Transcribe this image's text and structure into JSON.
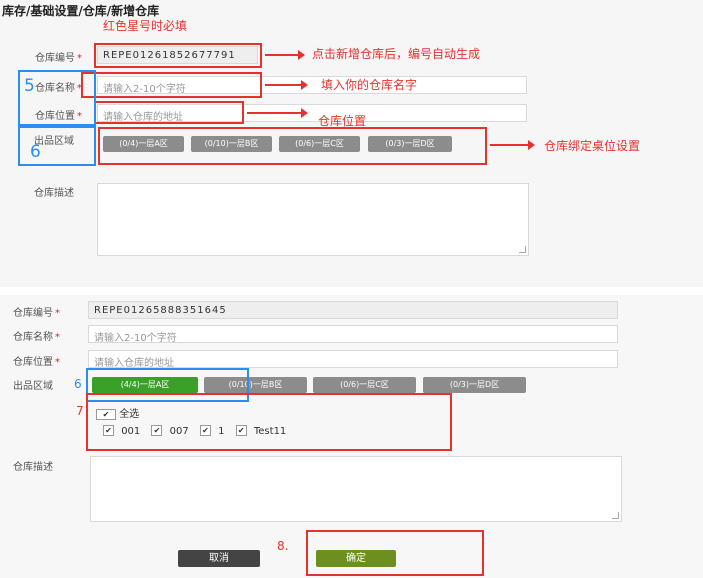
{
  "breadcrumb": "库存/基础设置/仓库/新增仓库",
  "form1": {
    "code_label": "仓库编号",
    "code_value": "REPE01261852677791",
    "name_label": "仓库名称",
    "name_placeholder": "请输入2-10个字符",
    "location_label": "仓库位置",
    "location_placeholder": "请输入仓库的地址",
    "zone_label": "出品区域",
    "zones": [
      "(0/4)一层A区",
      "(0/10)一层B区",
      "(0/6)一层C区",
      "(0/3)一层D区"
    ],
    "desc_label": "仓库描述"
  },
  "annotations1": {
    "required_hint": "红色星号时必填",
    "code_hint": "点击新增仓库后，编号自动生成",
    "name_hint": "填入你的仓库名字",
    "location_hint": "仓库位置",
    "zone_hint": "仓库绑定桌位设置",
    "step5": "5",
    "step6": "6"
  },
  "form2": {
    "code_label": "仓库编号",
    "code_value": "REPE01265888351645",
    "name_label": "仓库名称",
    "name_placeholder": "请输入2-10个字符",
    "location_label": "仓库位置",
    "location_placeholder": "请输入仓库的地址",
    "zone_label": "出品区域",
    "zones": [
      "(4/4)一层A区",
      "(0/10)一层B区",
      "(0/6)一层C区",
      "(0/3)一层D区"
    ],
    "select_all": "全选",
    "tables": [
      "001",
      "007",
      "1",
      "Test11"
    ],
    "desc_label": "仓库描述",
    "cancel": "取消",
    "confirm": "确定"
  },
  "annotations2": {
    "step6": "6",
    "step7": "7",
    "step8": "8."
  },
  "required_mark": "*",
  "check_glyph": "✔",
  "colors": {
    "annotation_red": "#e4332e",
    "annotation_blue": "#2d8cf0",
    "zone_active": "#3aa02a",
    "zone_idle": "#8c8c8c"
  }
}
